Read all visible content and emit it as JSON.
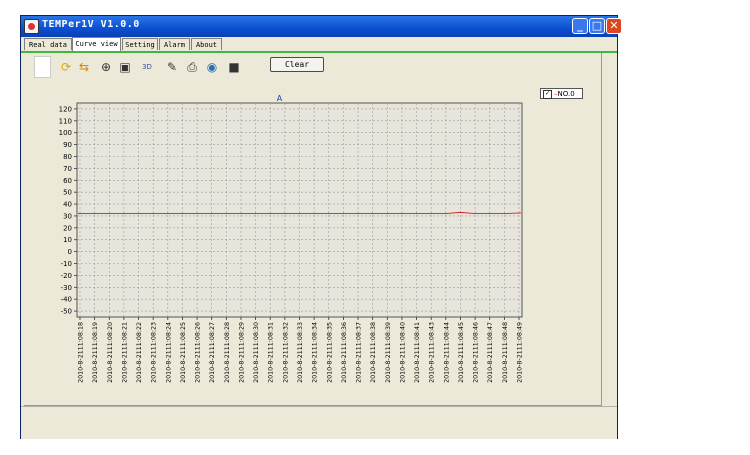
{
  "window": {
    "title": "TEMPer1V V1.0.0",
    "minimize": "_",
    "maximize": "□",
    "close": "✕"
  },
  "tabs": [
    {
      "label": "Real data",
      "active": false
    },
    {
      "label": "Curve view",
      "active": true
    },
    {
      "label": "Setting",
      "active": false
    },
    {
      "label": "Alarm",
      "active": false
    },
    {
      "label": "About",
      "active": false
    }
  ],
  "toolbar": {
    "icons": [
      "blank-icon",
      "refresh-icon",
      "move-icon",
      "zoom-in-icon",
      "fit-icon",
      "3d-icon",
      "chart-edit-icon",
      "print-icon",
      "export-icon",
      "save-icon"
    ],
    "three_d_label": "3D",
    "clear_label": "Clear"
  },
  "legend": {
    "checked": true,
    "label": "NO.0"
  },
  "chart_data": {
    "type": "line",
    "title": "A",
    "xlabel": "",
    "ylabel": "",
    "ylim": [
      -55,
      125
    ],
    "y_ticks": [
      120,
      110,
      100,
      90,
      80,
      70,
      60,
      50,
      40,
      30,
      20,
      10,
      0,
      -10,
      -20,
      -30,
      -40,
      -50
    ],
    "grid": true,
    "legend_position": "top-right",
    "categories": [
      "2010-8-2111:08:18",
      "2010-8-2111:08:19",
      "2010-8-2111:08:20",
      "2010-8-2111:08:21",
      "2010-8-2111:08:22",
      "2010-8-2111:08:23",
      "2010-8-2111:08:24",
      "2010-8-2111:08:25",
      "2010-8-2111:08:26",
      "2010-8-2111:08:27",
      "2010-8-2111:08:28",
      "2010-8-2111:08:29",
      "2010-8-2111:08:30",
      "2010-8-2111:08:31",
      "2010-8-2111:08:32",
      "2010-8-2111:08:33",
      "2010-8-2111:08:34",
      "2010-8-2111:08:35",
      "2010-8-2111:08:36",
      "2010-8-2111:08:37",
      "2010-8-2111:08:38",
      "2010-8-2111:08:39",
      "2010-8-2111:08:40",
      "2010-8-2111:08:41",
      "2010-8-2111:08:43",
      "2010-8-2111:08:44",
      "2010-8-2111:08:45",
      "2010-8-2111:08:46",
      "2010-8-2111:08:47",
      "2010-8-2111:08:48",
      "2010-8-2111:08:49"
    ],
    "series": [
      {
        "name": "NO.0",
        "color": "#cc2222",
        "values": [
          32,
          32,
          32,
          32,
          32,
          32,
          32,
          32,
          32,
          32,
          32,
          32,
          32,
          32,
          32,
          32,
          32,
          32,
          32,
          32,
          32,
          32,
          32,
          32,
          32,
          32,
          33,
          32,
          32,
          32,
          32.5
        ]
      }
    ]
  }
}
